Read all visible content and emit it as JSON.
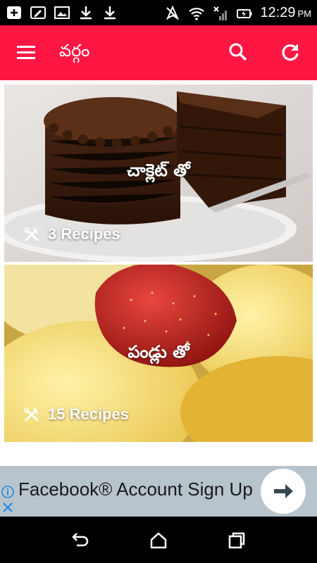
{
  "status_bar": {
    "time": "12:29",
    "ampm": "PM",
    "icons": [
      "add-box-icon",
      "edit-note-icon",
      "image-icon",
      "download-icon",
      "download-icon",
      "location-off-icon",
      "wifi-icon",
      "no-signal-icon",
      "battery-charging-icon"
    ]
  },
  "app_bar": {
    "title": "వర్గం",
    "color": "#ff1744",
    "icons": [
      "menu-icon",
      "search-icon",
      "refresh-icon"
    ]
  },
  "categories": [
    {
      "title": "చాక్లెట్ తో",
      "count": "3 Recipes",
      "image": "chocolate-cake"
    },
    {
      "title": "పండ్లు తో",
      "count": "15 Recipes",
      "image": "fruit-strawberry-sponge"
    }
  ],
  "ad": {
    "text": "Facebook® Account Sign Up",
    "icons": [
      "info-icon",
      "close-icon",
      "arrow-right-icon"
    ]
  },
  "nav_bar": {
    "icons": [
      "back-icon",
      "home-icon",
      "recents-icon"
    ]
  }
}
